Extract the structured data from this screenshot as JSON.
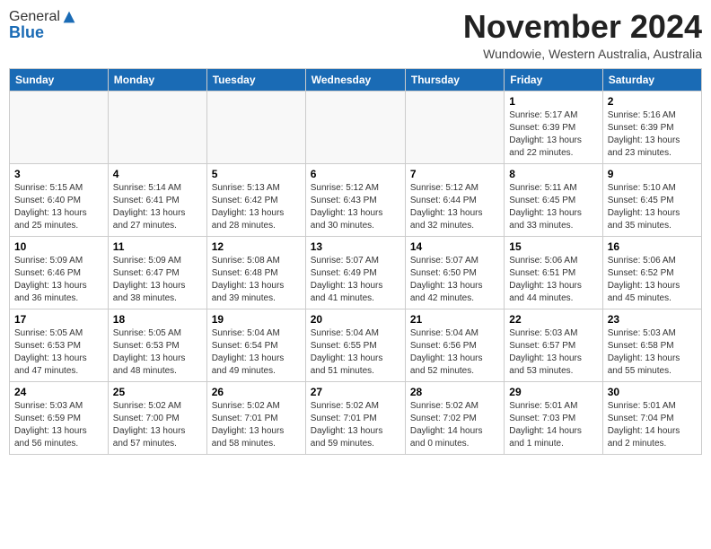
{
  "logo": {
    "general": "General",
    "blue": "Blue"
  },
  "header": {
    "month": "November 2024",
    "location": "Wundowie, Western Australia, Australia"
  },
  "weekdays": [
    "Sunday",
    "Monday",
    "Tuesday",
    "Wednesday",
    "Thursday",
    "Friday",
    "Saturday"
  ],
  "weeks": [
    [
      {
        "day": "",
        "info": ""
      },
      {
        "day": "",
        "info": ""
      },
      {
        "day": "",
        "info": ""
      },
      {
        "day": "",
        "info": ""
      },
      {
        "day": "",
        "info": ""
      },
      {
        "day": "1",
        "info": "Sunrise: 5:17 AM\nSunset: 6:39 PM\nDaylight: 13 hours\nand 22 minutes."
      },
      {
        "day": "2",
        "info": "Sunrise: 5:16 AM\nSunset: 6:39 PM\nDaylight: 13 hours\nand 23 minutes."
      }
    ],
    [
      {
        "day": "3",
        "info": "Sunrise: 5:15 AM\nSunset: 6:40 PM\nDaylight: 13 hours\nand 25 minutes."
      },
      {
        "day": "4",
        "info": "Sunrise: 5:14 AM\nSunset: 6:41 PM\nDaylight: 13 hours\nand 27 minutes."
      },
      {
        "day": "5",
        "info": "Sunrise: 5:13 AM\nSunset: 6:42 PM\nDaylight: 13 hours\nand 28 minutes."
      },
      {
        "day": "6",
        "info": "Sunrise: 5:12 AM\nSunset: 6:43 PM\nDaylight: 13 hours\nand 30 minutes."
      },
      {
        "day": "7",
        "info": "Sunrise: 5:12 AM\nSunset: 6:44 PM\nDaylight: 13 hours\nand 32 minutes."
      },
      {
        "day": "8",
        "info": "Sunrise: 5:11 AM\nSunset: 6:45 PM\nDaylight: 13 hours\nand 33 minutes."
      },
      {
        "day": "9",
        "info": "Sunrise: 5:10 AM\nSunset: 6:45 PM\nDaylight: 13 hours\nand 35 minutes."
      }
    ],
    [
      {
        "day": "10",
        "info": "Sunrise: 5:09 AM\nSunset: 6:46 PM\nDaylight: 13 hours\nand 36 minutes."
      },
      {
        "day": "11",
        "info": "Sunrise: 5:09 AM\nSunset: 6:47 PM\nDaylight: 13 hours\nand 38 minutes."
      },
      {
        "day": "12",
        "info": "Sunrise: 5:08 AM\nSunset: 6:48 PM\nDaylight: 13 hours\nand 39 minutes."
      },
      {
        "day": "13",
        "info": "Sunrise: 5:07 AM\nSunset: 6:49 PM\nDaylight: 13 hours\nand 41 minutes."
      },
      {
        "day": "14",
        "info": "Sunrise: 5:07 AM\nSunset: 6:50 PM\nDaylight: 13 hours\nand 42 minutes."
      },
      {
        "day": "15",
        "info": "Sunrise: 5:06 AM\nSunset: 6:51 PM\nDaylight: 13 hours\nand 44 minutes."
      },
      {
        "day": "16",
        "info": "Sunrise: 5:06 AM\nSunset: 6:52 PM\nDaylight: 13 hours\nand 45 minutes."
      }
    ],
    [
      {
        "day": "17",
        "info": "Sunrise: 5:05 AM\nSunset: 6:53 PM\nDaylight: 13 hours\nand 47 minutes."
      },
      {
        "day": "18",
        "info": "Sunrise: 5:05 AM\nSunset: 6:53 PM\nDaylight: 13 hours\nand 48 minutes."
      },
      {
        "day": "19",
        "info": "Sunrise: 5:04 AM\nSunset: 6:54 PM\nDaylight: 13 hours\nand 49 minutes."
      },
      {
        "day": "20",
        "info": "Sunrise: 5:04 AM\nSunset: 6:55 PM\nDaylight: 13 hours\nand 51 minutes."
      },
      {
        "day": "21",
        "info": "Sunrise: 5:04 AM\nSunset: 6:56 PM\nDaylight: 13 hours\nand 52 minutes."
      },
      {
        "day": "22",
        "info": "Sunrise: 5:03 AM\nSunset: 6:57 PM\nDaylight: 13 hours\nand 53 minutes."
      },
      {
        "day": "23",
        "info": "Sunrise: 5:03 AM\nSunset: 6:58 PM\nDaylight: 13 hours\nand 55 minutes."
      }
    ],
    [
      {
        "day": "24",
        "info": "Sunrise: 5:03 AM\nSunset: 6:59 PM\nDaylight: 13 hours\nand 56 minutes."
      },
      {
        "day": "25",
        "info": "Sunrise: 5:02 AM\nSunset: 7:00 PM\nDaylight: 13 hours\nand 57 minutes."
      },
      {
        "day": "26",
        "info": "Sunrise: 5:02 AM\nSunset: 7:01 PM\nDaylight: 13 hours\nand 58 minutes."
      },
      {
        "day": "27",
        "info": "Sunrise: 5:02 AM\nSunset: 7:01 PM\nDaylight: 13 hours\nand 59 minutes."
      },
      {
        "day": "28",
        "info": "Sunrise: 5:02 AM\nSunset: 7:02 PM\nDaylight: 14 hours\nand 0 minutes."
      },
      {
        "day": "29",
        "info": "Sunrise: 5:01 AM\nSunset: 7:03 PM\nDaylight: 14 hours\nand 1 minute."
      },
      {
        "day": "30",
        "info": "Sunrise: 5:01 AM\nSunset: 7:04 PM\nDaylight: 14 hours\nand 2 minutes."
      }
    ]
  ]
}
